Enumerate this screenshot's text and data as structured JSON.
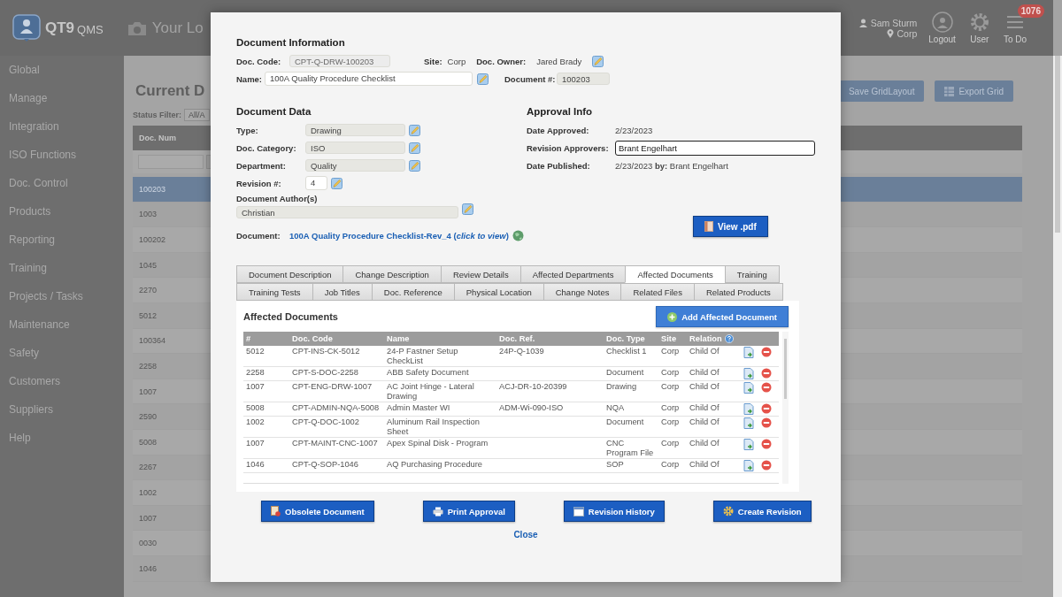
{
  "app": {
    "logo": {
      "brand": "QT9",
      "product": "QMS"
    },
    "header_link": "Your Lo",
    "user": {
      "name": "Sam Sturm",
      "site": "Corp"
    },
    "header_buttons": [
      {
        "label": "Logout",
        "kind": "logout"
      },
      {
        "label": "User",
        "kind": "user"
      },
      {
        "label": "To Do",
        "kind": "todo",
        "badge": "1076"
      }
    ]
  },
  "sidebar": {
    "items": [
      "Global",
      "Manage",
      "Integration",
      "ISO Functions",
      "Doc. Control",
      "Products",
      "Reporting",
      "Training",
      "Projects / Tasks",
      "Maintenance",
      "Safety",
      "Customers",
      "Suppliers",
      "Help"
    ]
  },
  "page": {
    "title": "Current D",
    "status_filter": {
      "label": "Status Filter:",
      "value": "All/A"
    },
    "buttons": [
      {
        "label": "Save GridLayout",
        "kind": "plain"
      },
      {
        "label": "Export Grid",
        "kind": "export"
      }
    ],
    "grid": {
      "columns": [
        "Doc. Num"
      ],
      "rows": [
        {
          "doc_num": "100203",
          "selected": true
        },
        {
          "doc_num": "1003",
          "selected": false
        },
        {
          "doc_num": "100202",
          "selected": false
        },
        {
          "doc_num": "1045",
          "selected": false
        },
        {
          "doc_num": "2270",
          "selected": false
        },
        {
          "doc_num": "5012",
          "selected": false
        },
        {
          "doc_num": "100364",
          "selected": false
        },
        {
          "doc_num": "2258",
          "selected": false
        },
        {
          "doc_num": "1007",
          "selected": false
        },
        {
          "doc_num": "2590",
          "selected": false
        },
        {
          "doc_num": "5008",
          "selected": false
        },
        {
          "doc_num": "2267",
          "selected": false
        },
        {
          "doc_num": "1002",
          "selected": false
        },
        {
          "doc_num": "1007",
          "selected": false
        },
        {
          "doc_num": "0030",
          "selected": false
        },
        {
          "doc_num": "1046",
          "selected": false
        }
      ]
    }
  },
  "dialog": {
    "document_information": {
      "title": "Document Information",
      "doc_code": {
        "label": "Doc. Code:",
        "value": "CPT-Q-DRW-100203"
      },
      "site": {
        "label": "Site:",
        "value": "Corp"
      },
      "doc_owner": {
        "label": "Doc. Owner:",
        "value": "Jared Brady"
      },
      "name": {
        "label": "Name:",
        "value": "100A Quality Procedure Checklist"
      },
      "document_number": {
        "label": "Document #:",
        "value": "100203"
      }
    },
    "document_data": {
      "title": "Document Data",
      "fields": [
        {
          "label": "Type:",
          "value": "Drawing",
          "kind": "select"
        },
        {
          "label": "Doc. Category:",
          "value": "ISO",
          "kind": "select"
        },
        {
          "label": "Department:",
          "value": "Quality",
          "kind": "select"
        },
        {
          "label": "Revision #:",
          "value": "4",
          "kind": "number"
        }
      ],
      "authors": {
        "label": "Document Author(s)",
        "value": "Christian"
      },
      "document": {
        "label": "Document:",
        "link": "100A Quality Procedure Checklist-Rev_4 (*click to view*)"
      }
    },
    "approval_info": {
      "title": "Approval Info",
      "date_approved": {
        "label": "Date Approved:",
        "value": "2/23/2023"
      },
      "revision_approvers": {
        "label": "Revision Approvers:",
        "value": "Brant Engelhart"
      },
      "date_published": {
        "label": "Date Published:",
        "value": "2/23/2023 **by:** Brant Engelhart"
      },
      "view_pdf": "View .pdf"
    },
    "tab_rows": [
      {
        "tabs": [
          {
            "label": "Document Description",
            "selected": false
          },
          {
            "label": "Change Description",
            "selected": false
          },
          {
            "label": "Review Details",
            "selected": false
          },
          {
            "label": "Affected Departments",
            "selected": false
          },
          {
            "label": "Affected Documents",
            "selected": true
          },
          {
            "label": "Training",
            "selected": false
          }
        ]
      },
      {
        "tabs": [
          {
            "label": "Training Tests",
            "selected": false
          },
          {
            "label": "Job Titles",
            "selected": false
          },
          {
            "label": "Doc. Reference",
            "selected": false
          },
          {
            "label": "Physical Location",
            "selected": false
          },
          {
            "label": "Change Notes",
            "selected": false
          },
          {
            "label": "Related Files",
            "selected": false
          },
          {
            "label": "Related Products",
            "selected": false
          }
        ]
      }
    ],
    "affected_documents": {
      "title": "Affected Documents",
      "add_button": "Add Affected Document",
      "columns": [
        "#",
        "Doc. Code",
        "Name",
        "Doc. Ref.",
        "Doc. Type",
        "Site",
        "Relation"
      ],
      "rows": [
        {
          "num": "5012",
          "doc_code": "CPT-INS-CK-5012",
          "name": "24-P Fastner Setup CheckList",
          "doc_ref": "24P-Q-1039",
          "doc_type": "Checklist 1",
          "site": "Corp",
          "relation": "Child Of"
        },
        {
          "num": "2258",
          "doc_code": "CPT-S-DOC-2258",
          "name": "ABB Safety Document",
          "doc_type": "Document",
          "site": "Corp",
          "relation": "Child Of"
        },
        {
          "num": "1007",
          "doc_code": "CPT-ENG-DRW-1007",
          "name": "AC Joint Hinge - Lateral Drawing",
          "doc_ref": "ACJ-DR-10-20399",
          "doc_type": "Drawing",
          "site": "Corp",
          "relation": "Child Of"
        },
        {
          "num": "5008",
          "doc_code": "CPT-ADMIN-NQA-5008",
          "name": "Admin Master WI",
          "doc_ref": "ADM-Wi-090-ISO",
          "doc_type": "NQA",
          "site": "Corp",
          "relation": "Child Of"
        },
        {
          "num": "1002",
          "doc_code": "CPT-Q-DOC-1002",
          "name": "Aluminum Rail Inspection Sheet",
          "doc_type": "Document",
          "site": "Corp",
          "relation": "Child Of"
        },
        {
          "num": "1007",
          "doc_code": "CPT-MAINT-CNC-1007",
          "name": "Apex Spinal Disk - Program",
          "doc_type": "CNC Program File",
          "site": "Corp",
          "relation": "Child Of"
        },
        {
          "num": "1046",
          "doc_code": "CPT-Q-SOP-1046",
          "name": "AQ Purchasing Procedure",
          "doc_type": "SOP",
          "site": "Corp",
          "relation": "Child Of"
        }
      ]
    },
    "actions": [
      {
        "label": "Obsolete Document",
        "kind": "obsolete"
      },
      {
        "label": "Print Approval",
        "kind": "print"
      },
      {
        "label": "Revision History",
        "kind": "history"
      },
      {
        "label": "Create Revision",
        "kind": "create"
      }
    ],
    "close": "Close"
  }
}
